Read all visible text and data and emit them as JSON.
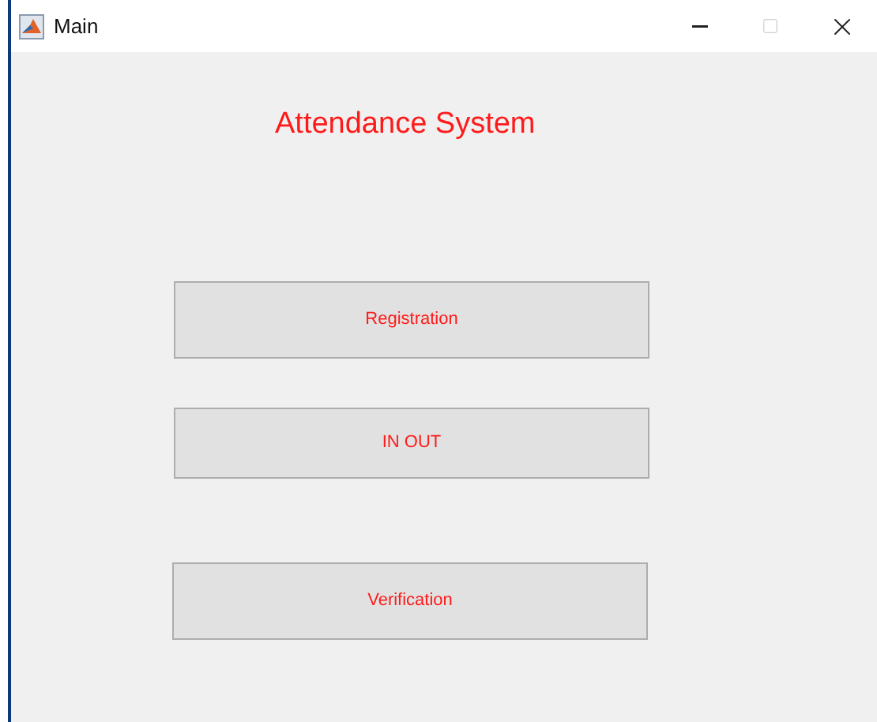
{
  "window": {
    "title": "Main"
  },
  "heading": "Attendance System",
  "buttons": [
    {
      "label": "Registration"
    },
    {
      "label": "IN OUT"
    },
    {
      "label": "Verification"
    }
  ]
}
